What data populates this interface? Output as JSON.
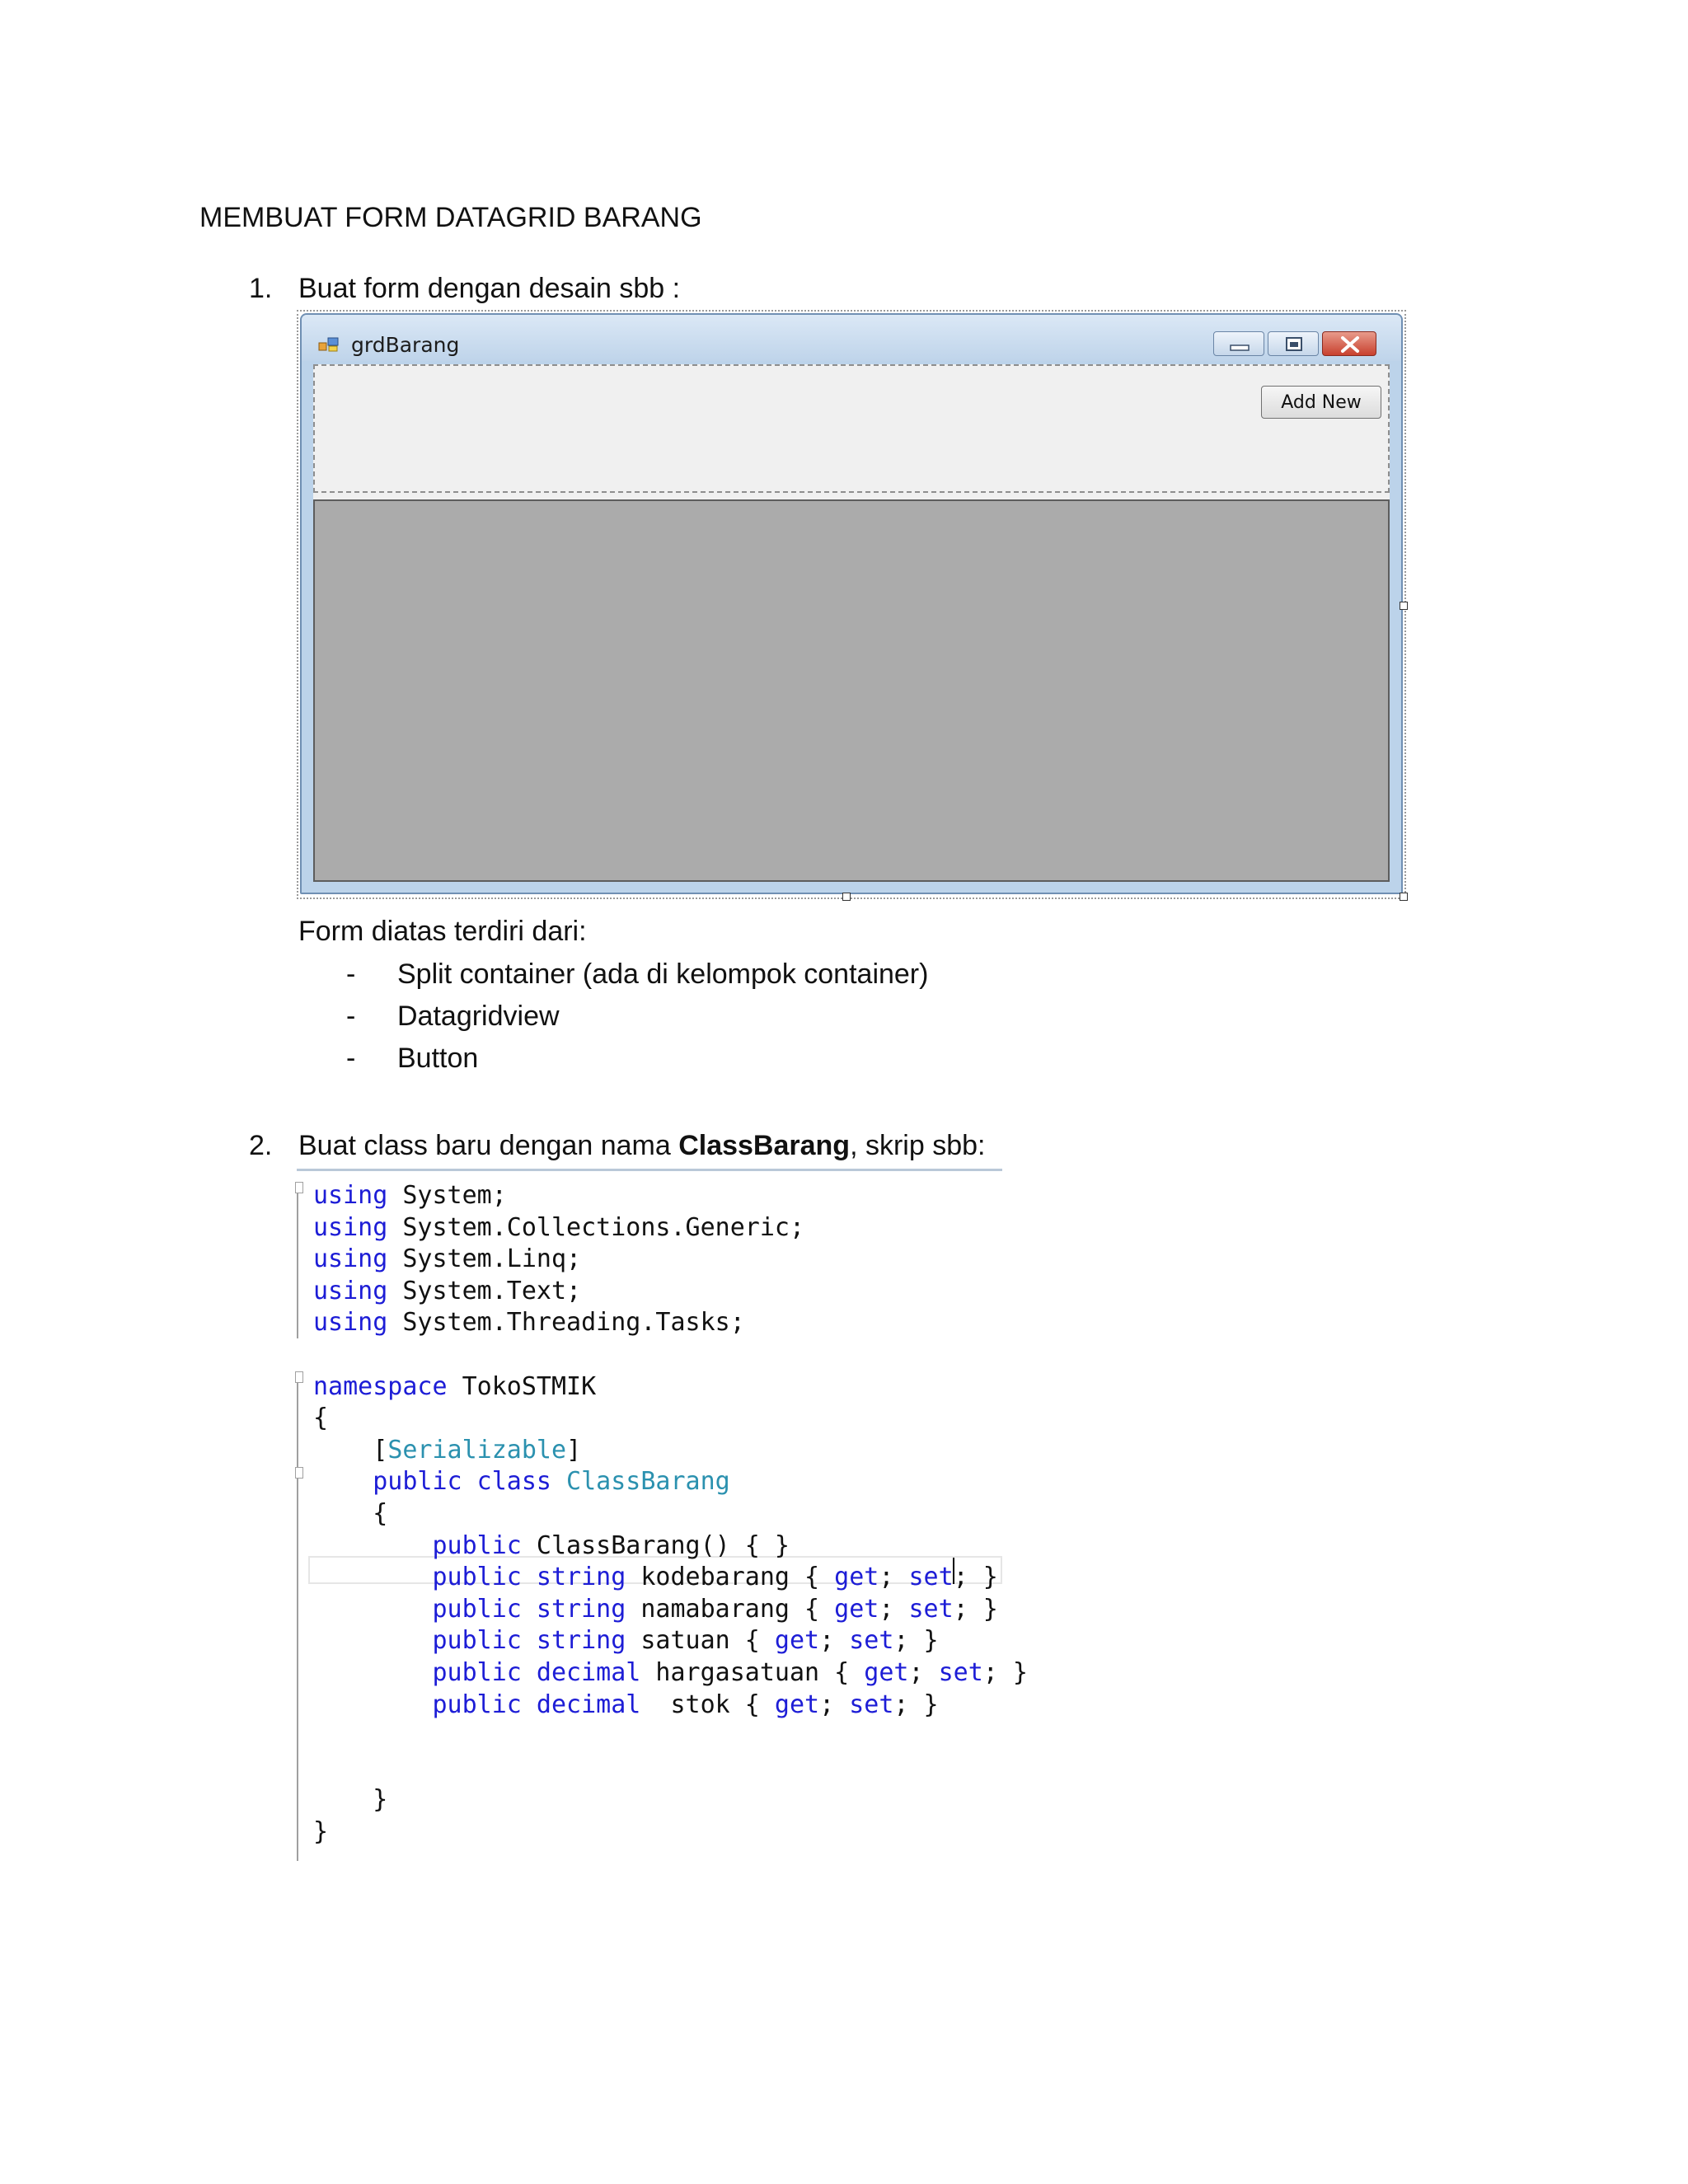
{
  "document": {
    "title": "MEMBUAT FORM DATAGRID BARANG",
    "step1": {
      "number": "1.",
      "text": "Buat form dengan desain sbb :"
    },
    "form_window": {
      "title": "grdBarang",
      "add_button_label": "Add New",
      "icon": "form-icon",
      "caption_icons": [
        "minimize-icon",
        "maximize-icon",
        "close-icon"
      ]
    },
    "form_consists_label": "Form diatas terdiri dari:",
    "components": [
      {
        "dash": "-",
        "text": "Split container (ada di kelompok container)"
      },
      {
        "dash": "-",
        "text": "Datagridview"
      },
      {
        "dash": "-",
        "text": "Button"
      }
    ],
    "step2": {
      "number": "2.",
      "text_before": "Buat class baru dengan nama ",
      "text_bold": "ClassBarang",
      "text_after": ", skrip sbb:"
    }
  },
  "code": {
    "lines": [
      [
        {
          "k": "kw",
          "t": "using"
        },
        {
          "k": "",
          "t": " System;"
        }
      ],
      [
        {
          "k": "kw",
          "t": "using"
        },
        {
          "k": "",
          "t": " System.Collections.Generic;"
        }
      ],
      [
        {
          "k": "kw",
          "t": "using"
        },
        {
          "k": "",
          "t": " System.Linq;"
        }
      ],
      [
        {
          "k": "kw",
          "t": "using"
        },
        {
          "k": "",
          "t": " System.Text;"
        }
      ],
      [
        {
          "k": "kw",
          "t": "using"
        },
        {
          "k": "",
          "t": " System.Threading.Tasks;"
        }
      ],
      [],
      [
        {
          "k": "kw",
          "t": "namespace"
        },
        {
          "k": "",
          "t": " TokoSTMIK"
        }
      ],
      [
        {
          "k": "",
          "t": "{"
        }
      ],
      [
        {
          "k": "",
          "t": "    ["
        },
        {
          "k": "ty",
          "t": "Serializable"
        },
        {
          "k": "",
          "t": "]"
        }
      ],
      [
        {
          "k": "kw",
          "t": "    public class"
        },
        {
          "k": "",
          "t": " "
        },
        {
          "k": "ty",
          "t": "ClassBarang"
        }
      ],
      [
        {
          "k": "",
          "t": "    {"
        }
      ],
      [
        {
          "k": "kw",
          "t": "        public"
        },
        {
          "k": "",
          "t": " ClassBarang() { }"
        }
      ],
      [
        {
          "k": "kw",
          "t": "        public string"
        },
        {
          "k": "",
          "t": " kodebarang { "
        },
        {
          "k": "kw",
          "t": "get"
        },
        {
          "k": "",
          "t": "; "
        },
        {
          "k": "kw",
          "t": "set"
        },
        {
          "k": "",
          "t": "; }"
        }
      ],
      [
        {
          "k": "kw",
          "t": "        public string"
        },
        {
          "k": "",
          "t": " namabarang { "
        },
        {
          "k": "kw",
          "t": "get"
        },
        {
          "k": "",
          "t": "; "
        },
        {
          "k": "kw",
          "t": "set"
        },
        {
          "k": "",
          "t": "; }"
        }
      ],
      [
        {
          "k": "kw",
          "t": "        public string"
        },
        {
          "k": "",
          "t": " satuan { "
        },
        {
          "k": "kw",
          "t": "get"
        },
        {
          "k": "",
          "t": "; "
        },
        {
          "k": "kw",
          "t": "set"
        },
        {
          "k": "",
          "t": "; }"
        }
      ],
      [
        {
          "k": "kw",
          "t": "        public decimal"
        },
        {
          "k": "",
          "t": " hargasatuan { "
        },
        {
          "k": "kw",
          "t": "get"
        },
        {
          "k": "",
          "t": "; "
        },
        {
          "k": "kw",
          "t": "set"
        },
        {
          "k": "",
          "t": "; }"
        }
      ],
      [
        {
          "k": "kw",
          "t": "        public decimal"
        },
        {
          "k": "",
          "t": "  stok { "
        },
        {
          "k": "kw",
          "t": "get"
        },
        {
          "k": "",
          "t": "; "
        },
        {
          "k": "kw",
          "t": "set"
        },
        {
          "k": "",
          "t": "; }"
        }
      ],
      [],
      [],
      [
        {
          "k": "",
          "t": "    }"
        }
      ],
      [
        {
          "k": "",
          "t": "}"
        }
      ]
    ],
    "keyword_color": "#1d1dd6",
    "type_color": "#2b91af"
  }
}
